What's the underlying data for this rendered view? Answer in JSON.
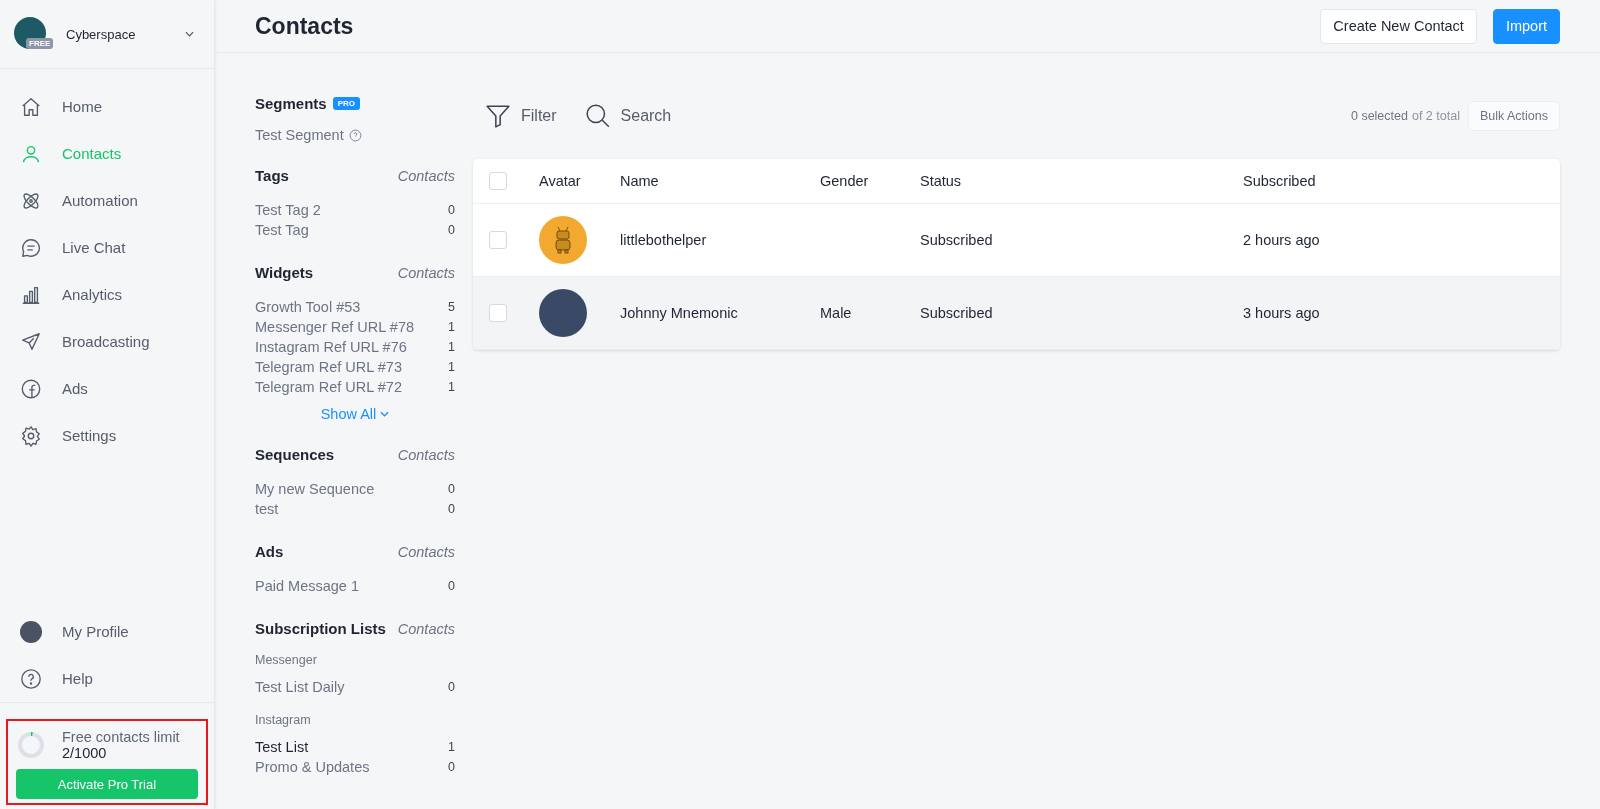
{
  "workspace": {
    "name": "Cyberspace",
    "plan_badge": "FREE"
  },
  "nav": [
    {
      "label": "Home",
      "selected": false
    },
    {
      "label": "Contacts",
      "selected": true
    },
    {
      "label": "Automation",
      "selected": false
    },
    {
      "label": "Live Chat",
      "selected": false
    },
    {
      "label": "Analytics",
      "selected": false
    },
    {
      "label": "Broadcasting",
      "selected": false
    },
    {
      "label": "Ads",
      "selected": false
    },
    {
      "label": "Settings",
      "selected": false
    }
  ],
  "bottom_nav": [
    {
      "label": "My Profile"
    },
    {
      "label": "Help"
    }
  ],
  "limit": {
    "title": "Free contacts limit",
    "value": "2/1000",
    "level": 0.002,
    "button": "Activate Pro Trial"
  },
  "header": {
    "title": "Contacts",
    "buttons": [
      {
        "label": "Create New Contact",
        "primary": false
      },
      {
        "label": "Import",
        "primary": true
      }
    ]
  },
  "segments": {
    "title": "Segments",
    "badge": "PRO",
    "items": [
      "Test Segment"
    ]
  },
  "groups": [
    {
      "title": "Tags",
      "column": "Contacts",
      "items": [
        {
          "name": "Test Tag 2",
          "count": "0"
        },
        {
          "name": "Test Tag",
          "count": "0"
        }
      ]
    },
    {
      "title": "Widgets",
      "column": "Contacts",
      "items": [
        {
          "name": "Growth Tool #53",
          "count": "5"
        },
        {
          "name": "Messenger Ref URL #78",
          "count": "1"
        },
        {
          "name": "Instagram Ref URL #76",
          "count": "1"
        },
        {
          "name": "Telegram Ref URL #73",
          "count": "1"
        },
        {
          "name": "Telegram Ref URL #72",
          "count": "1"
        }
      ],
      "show_all": "Show All"
    },
    {
      "title": "Sequences",
      "column": "Contacts",
      "items": [
        {
          "name": "My new Sequence",
          "count": "0"
        },
        {
          "name": "test",
          "count": "0"
        }
      ]
    },
    {
      "title": "Ads",
      "column": "Contacts",
      "items": [
        {
          "name": "Paid Message 1",
          "count": "0"
        }
      ]
    },
    {
      "title": "Subscription Lists",
      "column": "Contacts",
      "subgroups": [
        {
          "channel": "Messenger",
          "items": [
            {
              "name": "Test List Daily",
              "count": "0"
            }
          ]
        },
        {
          "channel": "Instagram",
          "items": [
            {
              "name": "Test List",
              "count": "1"
            },
            {
              "name": "Promo & Updates",
              "count": "0"
            }
          ]
        }
      ]
    }
  ],
  "toolbar": {
    "filter": "Filter",
    "search": "Search",
    "selected_count": "0 selected",
    "total": "of 2 total",
    "bulk": "Bulk Actions"
  },
  "table": {
    "columns": [
      "Avatar",
      "Name",
      "Gender",
      "Status",
      "Subscribed"
    ],
    "all_checked": false,
    "rows": [
      {
        "kind": "bot",
        "name": "littlebothelper",
        "gender": "",
        "status": "Subscribed",
        "subscribed": "2 hours ago",
        "checked": false,
        "hovered": false
      },
      {
        "kind": "person",
        "name": "Johnny Mnemonic",
        "gender": "Male",
        "status": "Subscribed",
        "subscribed": "3 hours ago",
        "checked": false,
        "hovered": true
      }
    ]
  }
}
